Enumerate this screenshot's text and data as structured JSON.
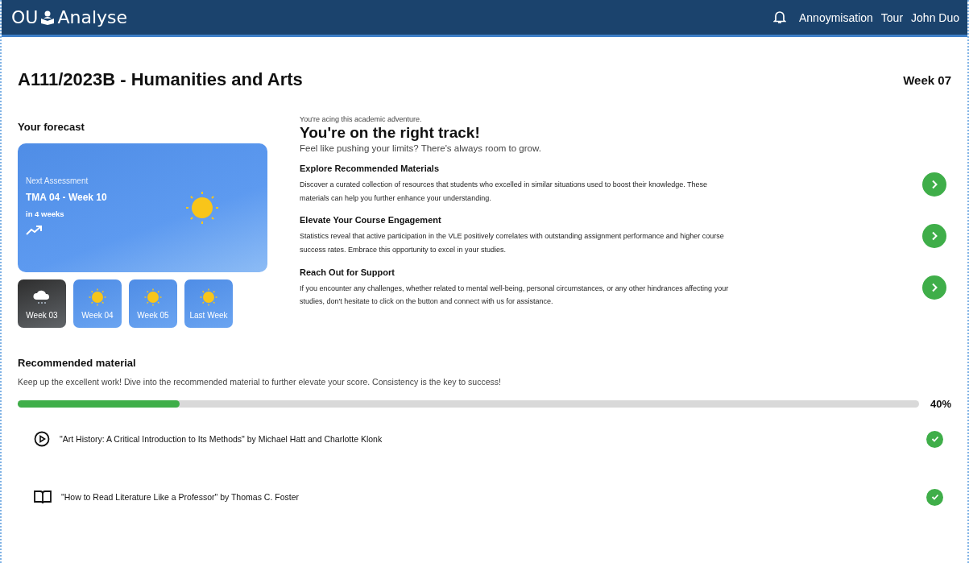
{
  "header": {
    "logo_left": "OU",
    "logo_right": "Analyse",
    "nav": [
      "Annoymisation",
      "Tour",
      "John Duo"
    ]
  },
  "course": {
    "title": "A111/2023B - Humanities and Arts",
    "week": "Week 07"
  },
  "forecast": {
    "heading": "Your forecast",
    "label": "Next Assessment",
    "assessment": "TMA 04 - Week 10",
    "due": "in 4 weeks",
    "weeks": [
      {
        "label": "Week 03",
        "kind": "rain"
      },
      {
        "label": "Week 04",
        "kind": "sun"
      },
      {
        "label": "Week 05",
        "kind": "sun"
      },
      {
        "label": "Last Week",
        "kind": "sun"
      }
    ]
  },
  "advice": {
    "kicker": "You're acing this academic adventure.",
    "headline": "You're on the right track!",
    "subline": "Feel like pushing your limits? There's always room to grow.",
    "items": [
      {
        "title": "Explore Recommended Materials",
        "text": "Discover a curated collection of resources that students who excelled in similar situations used to boost their knowledge. These materials can help you further enhance your understanding."
      },
      {
        "title": "Elevate Your Course Engagement",
        "text": "Statistics reveal that active participation in the VLE positively correlates with outstanding assignment performance and higher course success rates. Embrace this opportunity to excel in your studies."
      },
      {
        "title": "Reach Out for Support",
        "text": "If you encounter any challenges, whether related to mental well-being, personal circumstances, or any other hindrances affecting your studies, don't hesitate to click on the button and connect with us for assistance."
      }
    ]
  },
  "recommended": {
    "heading": "Recommended material",
    "text": "Keep up the excellent work! Dive into the recommended material to further elevate your score. Consistency is the key to success!",
    "level": 0.18,
    "percent": "40%",
    "items": [
      {
        "kind": "video",
        "title": "\"Art History: A Critical Introduction to Its Methods\" by Michael Hatt and Charlotte Klonk",
        "done": true
      },
      {
        "kind": "book",
        "title": "\"How to Read Literature Like a Professor\" by Thomas C. Foster",
        "done": true
      }
    ]
  }
}
